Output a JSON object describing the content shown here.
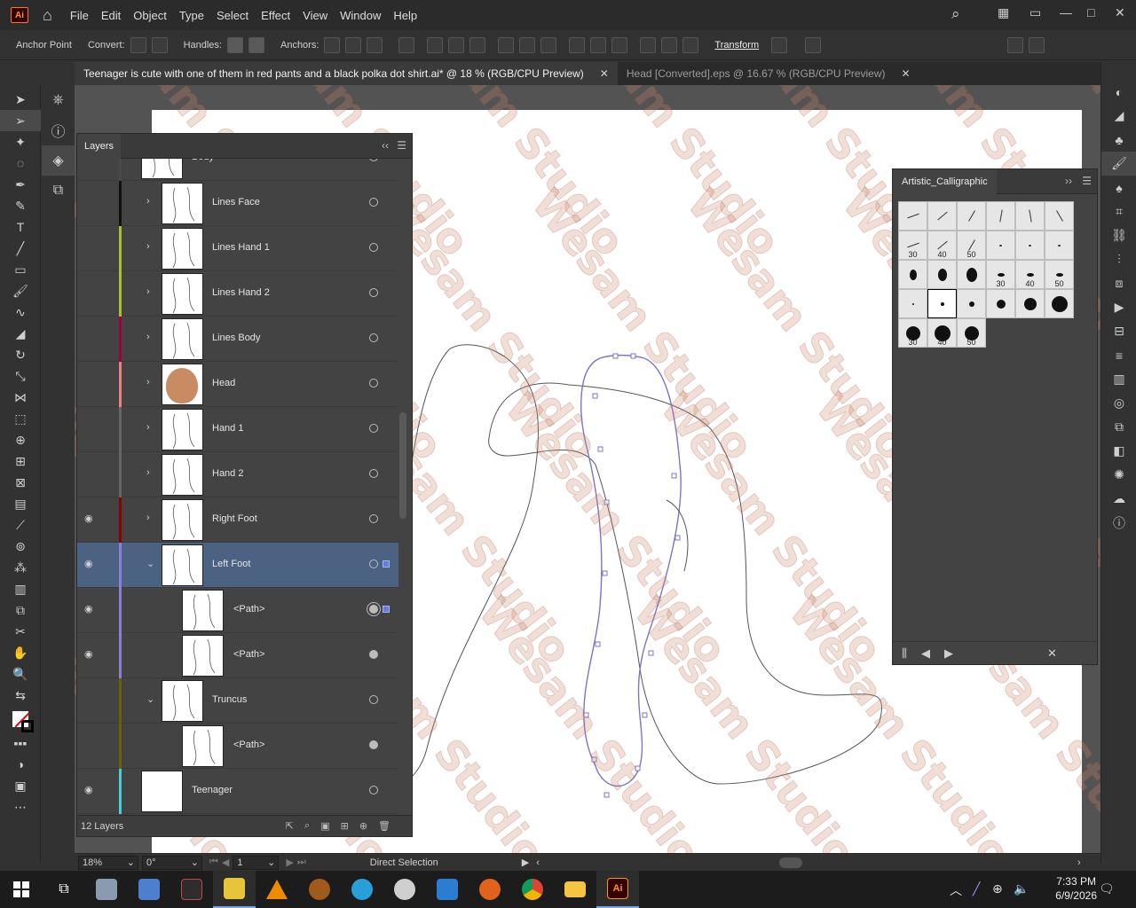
{
  "app": {
    "logo": "Ai",
    "menu": [
      "File",
      "Edit",
      "Object",
      "Type",
      "Select",
      "Effect",
      "View",
      "Window",
      "Help"
    ]
  },
  "control_bar": {
    "tool_label": "Anchor Point",
    "convert_label": "Convert:",
    "handles_label": "Handles:",
    "anchors_label": "Anchors:",
    "transform_label": "Transform"
  },
  "tabs": [
    {
      "title": "Teenager is cute with one of them in red pants and a black polka dot shirt.ai* @ 18 % (RGB/CPU Preview)",
      "active": true
    },
    {
      "title": "Head [Converted].eps @ 16.67 % (RGB/CPU Preview)",
      "active": false
    }
  ],
  "layers_panel": {
    "title": "Layers",
    "footer_count": "12 Layers",
    "rows": [
      {
        "name": "Body",
        "eye": false,
        "color": "#4a4a4a",
        "expandable": false,
        "sub": false,
        "selected": false
      },
      {
        "name": "Lines Face",
        "eye": false,
        "color": "#111111",
        "expandable": true,
        "sub": false,
        "selected": false
      },
      {
        "name": "Lines Hand 1",
        "eye": false,
        "color": "#a7c230",
        "expandable": true,
        "sub": false,
        "selected": false
      },
      {
        "name": "Lines Hand 2",
        "eye": false,
        "color": "#a7c230",
        "expandable": true,
        "sub": false,
        "selected": false
      },
      {
        "name": "Lines Body",
        "eye": false,
        "color": "#a0003c",
        "expandable": true,
        "sub": false,
        "selected": false
      },
      {
        "name": "Head",
        "eye": false,
        "color": "#f08080",
        "expandable": true,
        "sub": false,
        "selected": false
      },
      {
        "name": "Hand 1",
        "eye": false,
        "color": "#666666",
        "expandable": true,
        "sub": false,
        "selected": false
      },
      {
        "name": "Hand 2",
        "eye": false,
        "color": "#666666",
        "expandable": true,
        "sub": false,
        "selected": false
      },
      {
        "name": "Right Foot",
        "eye": true,
        "color": "#8b0000",
        "expandable": true,
        "sub": false,
        "selected": false
      },
      {
        "name": "Left Foot",
        "eye": true,
        "color": "#8a7fd8",
        "expandable": true,
        "expanded": true,
        "sub": false,
        "selected": true
      },
      {
        "name": "<Path>",
        "eye": true,
        "color": "#8a7fd8",
        "expandable": false,
        "sub": true,
        "selected": false
      },
      {
        "name": "<Path>",
        "eye": true,
        "color": "#8a7fd8",
        "expandable": false,
        "sub": true,
        "selected": false
      },
      {
        "name": "Truncus",
        "eye": false,
        "color": "#6b5f00",
        "expandable": true,
        "expanded": true,
        "sub": false,
        "selected": false
      },
      {
        "name": "<Path>",
        "eye": false,
        "color": "#6b5f00",
        "expandable": false,
        "sub": true,
        "selected": false
      },
      {
        "name": "Teenager",
        "eye": true,
        "color": "#3fd0d8",
        "expandable": false,
        "sub": false,
        "selected": false
      }
    ]
  },
  "brushes_panel": {
    "title": "Artistic_Calligraphic",
    "rows": [
      [
        "",
        "",
        "",
        "",
        "",
        ""
      ],
      [
        "30",
        "40",
        "50",
        "",
        "",
        ""
      ],
      [
        "",
        "",
        "",
        "30",
        "40",
        "50"
      ],
      [
        "",
        "",
        "",
        "",
        "",
        ""
      ],
      [
        "30",
        "40",
        "50"
      ]
    ]
  },
  "status_bar": {
    "zoom": "18%",
    "rotation": "0°",
    "artboard": "1",
    "tool": "Direct Selection"
  },
  "watermark_text": "Wesam Studio",
  "taskbar": {
    "time": "7:33 PM",
    "date": "6/9/2026"
  },
  "colors": {
    "selection_blue": "#4b6282",
    "path_color": "#7b74c9",
    "accent": "#ff9a00"
  }
}
